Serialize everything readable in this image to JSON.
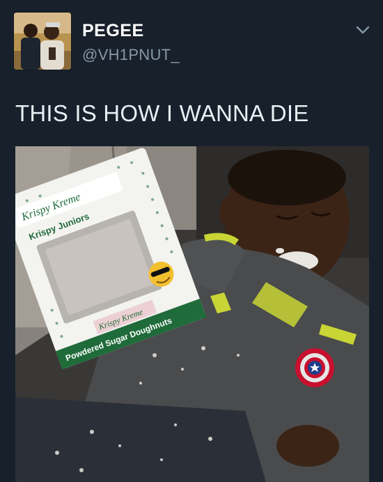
{
  "tweet": {
    "author": {
      "display_name": "PEGEE",
      "handle": "@VH1PNUT_",
      "avatar_icon": "profile-photo"
    },
    "menu_icon": "chevron-down-icon",
    "text": "THIS IS HOW I WANNA DIE",
    "media": {
      "bag_brand": "Krispy Kreme",
      "bag_line": "Krispy Juniors",
      "bag_product": "Powdered Sugar Doughnuts"
    }
  },
  "colors": {
    "background": "#17202b",
    "name": "#ffffff",
    "handle": "#8899a6",
    "krispy_green": "#1f6b3a",
    "krispy_red": "#c8102e"
  }
}
